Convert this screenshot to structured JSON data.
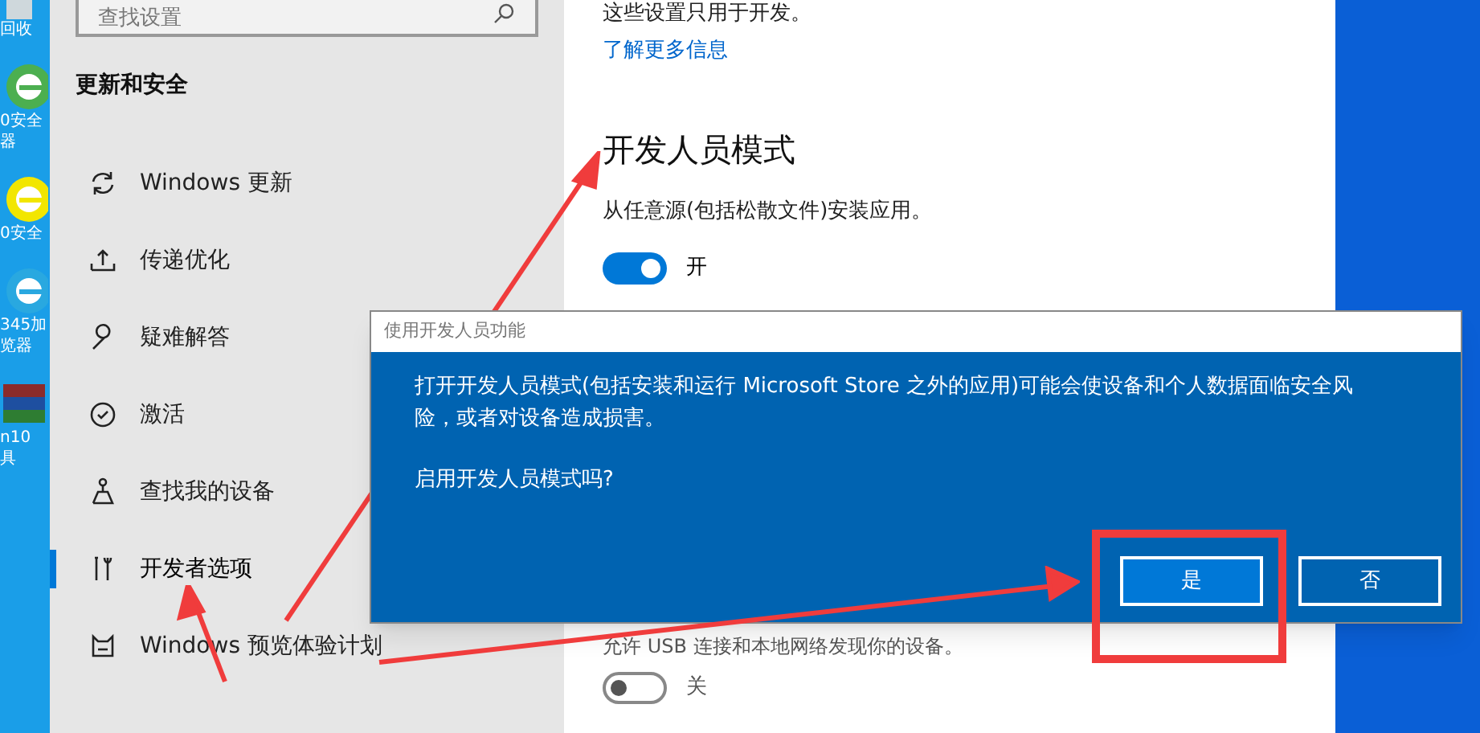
{
  "desktop_icons": [
    {
      "labels": [
        "回收"
      ],
      "kind": "bin"
    },
    {
      "labels": [
        "0安全",
        "器"
      ],
      "kind": "green"
    },
    {
      "labels": [
        "0安全"
      ],
      "kind": "yellow"
    },
    {
      "labels": [
        "345加",
        "览器"
      ],
      "kind": "blue"
    },
    {
      "labels": [
        "n10",
        "具"
      ],
      "kind": "archive"
    }
  ],
  "sidebar": {
    "search": {
      "placeholder": "查找设置"
    },
    "heading": "更新和安全",
    "items": [
      {
        "label": "Windows 更新",
        "kind": "refresh",
        "selected": false
      },
      {
        "label": "传递优化",
        "kind": "upload",
        "selected": false
      },
      {
        "label": "疑难解答",
        "kind": "wrench",
        "selected": false
      },
      {
        "label": "激活",
        "kind": "check",
        "selected": false
      },
      {
        "label": "查找我的设备",
        "kind": "person",
        "selected": false
      },
      {
        "label": "开发者选项",
        "kind": "tools",
        "selected": true
      },
      {
        "label": "Windows 预览体验计划",
        "kind": "cat",
        "selected": false
      }
    ]
  },
  "content": {
    "intro": "这些设置只用于开发。",
    "link": "了解更多信息",
    "section_title": "开发人员模式",
    "description": "从任意源(包括松散文件)安装应用。",
    "toggle": {
      "on": true,
      "label": "开"
    },
    "partial_text": "允许 USB 连接和本地网络发现你的设备。",
    "toggle_2": {
      "on": false,
      "label": "关"
    }
  },
  "dialog": {
    "title": "使用开发人员功能",
    "message": "打开开发人员模式(包括安装和运行 Microsoft Store 之外的应用)可能会使设备和个人数据面临安全风险，或者对设备造成损害。",
    "question": "启用开发人员模式吗?",
    "buttons": [
      {
        "label": "是",
        "selected": true
      },
      {
        "label": "否",
        "selected": false
      }
    ]
  }
}
